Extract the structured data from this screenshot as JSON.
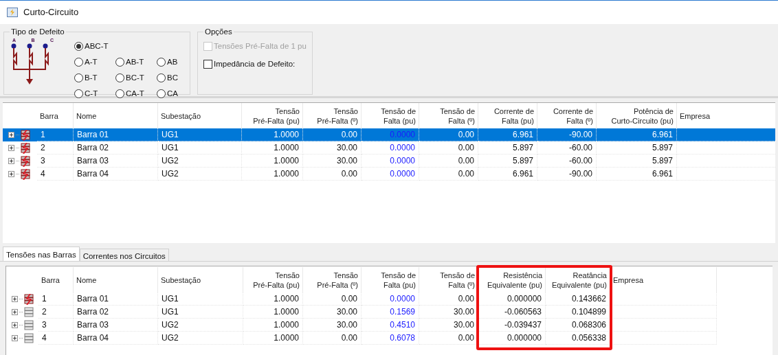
{
  "window": {
    "title": "Curto-Circuito"
  },
  "fault_type": {
    "title": "Tipo de Defeito",
    "phase_labels": [
      "A",
      "B",
      "C"
    ],
    "options": [
      {
        "label": "ABC-T",
        "selected": true
      },
      {
        "label": "A-T",
        "selected": false
      },
      {
        "label": "AB-T",
        "selected": false
      },
      {
        "label": "AB",
        "selected": false
      },
      {
        "label": "B-T",
        "selected": false
      },
      {
        "label": "BC-T",
        "selected": false
      },
      {
        "label": "BC",
        "selected": false
      },
      {
        "label": "C-T",
        "selected": false
      },
      {
        "label": "CA-T",
        "selected": false
      },
      {
        "label": "CA",
        "selected": false
      }
    ]
  },
  "options": {
    "title": "Opções",
    "checkboxes": [
      {
        "label": "Tensões Pré-Falta de 1 pu",
        "checked": false,
        "disabled": true
      },
      {
        "label": "Impedância de Defeito:",
        "checked": false,
        "disabled": false
      }
    ]
  },
  "top_table": {
    "columns": [
      {
        "label": "Barra"
      },
      {
        "label": "Nome"
      },
      {
        "label": "Subestação"
      },
      {
        "label": "Tensão\nPré-Falta (pu)"
      },
      {
        "label": "Tensão\nPré-Falta (º)"
      },
      {
        "label": "Tensão de\nFalta (pu)",
        "blue": true
      },
      {
        "label": "Tensão de\nFalta (º)"
      },
      {
        "label": "Corrente de\nFalta (pu)"
      },
      {
        "label": "Corrente de\nFalta (º)"
      },
      {
        "label": "Potência de\nCurto-Circuito (pu)"
      },
      {
        "label": "Empresa"
      }
    ],
    "rows": [
      {
        "selected": true,
        "faulted": true,
        "cells": [
          "1",
          "Barra 01",
          "UG1",
          "1.0000",
          "0.00",
          "0.0000",
          "0.00",
          "6.961",
          "-90.00",
          "6.961"
        ]
      },
      {
        "selected": false,
        "faulted": true,
        "cells": [
          "2",
          "Barra 02",
          "UG1",
          "1.0000",
          "30.00",
          "0.0000",
          "0.00",
          "5.897",
          "-60.00",
          "5.897"
        ]
      },
      {
        "selected": false,
        "faulted": true,
        "cells": [
          "3",
          "Barra 03",
          "UG2",
          "1.0000",
          "30.00",
          "0.0000",
          "0.00",
          "5.897",
          "-60.00",
          "5.897"
        ]
      },
      {
        "selected": false,
        "faulted": true,
        "cells": [
          "4",
          "Barra 04",
          "UG2",
          "1.0000",
          "0.00",
          "0.0000",
          "0.00",
          "6.961",
          "-90.00",
          "6.961"
        ]
      }
    ]
  },
  "tabs": [
    {
      "label": "Tensões nas Barras",
      "selected": true
    },
    {
      "label": "Correntes nos Circuitos",
      "selected": false
    }
  ],
  "bottom_table": {
    "columns": [
      {
        "label": "Barra"
      },
      {
        "label": "Nome"
      },
      {
        "label": "Subestação"
      },
      {
        "label": "Tensão\nPré-Falta (pu)"
      },
      {
        "label": "Tensão\nPré-Falta (º)"
      },
      {
        "label": "Tensão de\nFalta (pu)",
        "blue": true
      },
      {
        "label": "Tensão de\nFalta (º)"
      },
      {
        "label": "Resistência\nEquivalente (pu)",
        "highlighted": true
      },
      {
        "label": "Reatância\nEquivalente (pu)",
        "highlighted": true
      },
      {
        "label": "Empresa"
      }
    ],
    "rows": [
      {
        "faulted": true,
        "cells": [
          "1",
          "Barra 01",
          "UG1",
          "1.0000",
          "0.00",
          "0.0000",
          "0.00",
          "0.000000",
          "0.143662"
        ]
      },
      {
        "faulted": false,
        "cells": [
          "2",
          "Barra 02",
          "UG1",
          "1.0000",
          "30.00",
          "0.1569",
          "30.00",
          "-0.060563",
          "0.104899"
        ]
      },
      {
        "faulted": false,
        "cells": [
          "3",
          "Barra 03",
          "UG2",
          "1.0000",
          "30.00",
          "0.4510",
          "30.00",
          "-0.039437",
          "0.068306"
        ]
      },
      {
        "faulted": false,
        "cells": [
          "4",
          "Barra 04",
          "UG2",
          "1.0000",
          "0.00",
          "0.6078",
          "0.00",
          "0.000000",
          "0.056338"
        ]
      }
    ]
  }
}
